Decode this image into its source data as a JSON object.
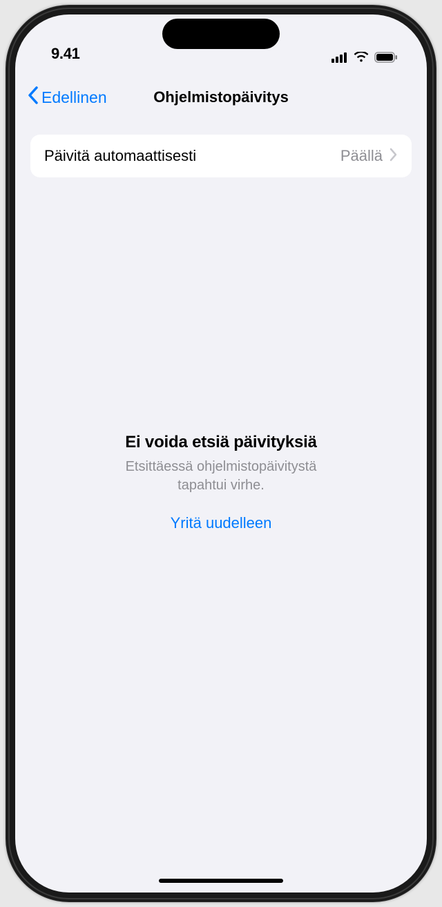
{
  "status_bar": {
    "time": "9.41"
  },
  "nav": {
    "back_label": "Edellinen",
    "title": "Ohjelmistopäivitys"
  },
  "settings": {
    "auto_update_label": "Päivitä automaattisesti",
    "auto_update_value": "Päällä"
  },
  "error": {
    "title": "Ei voida etsiä päivityksiä",
    "message_line1": "Etsittäessä ohjelmistopäivitystä",
    "message_line2": "tapahtui virhe.",
    "retry_label": "Yritä uudelleen"
  }
}
